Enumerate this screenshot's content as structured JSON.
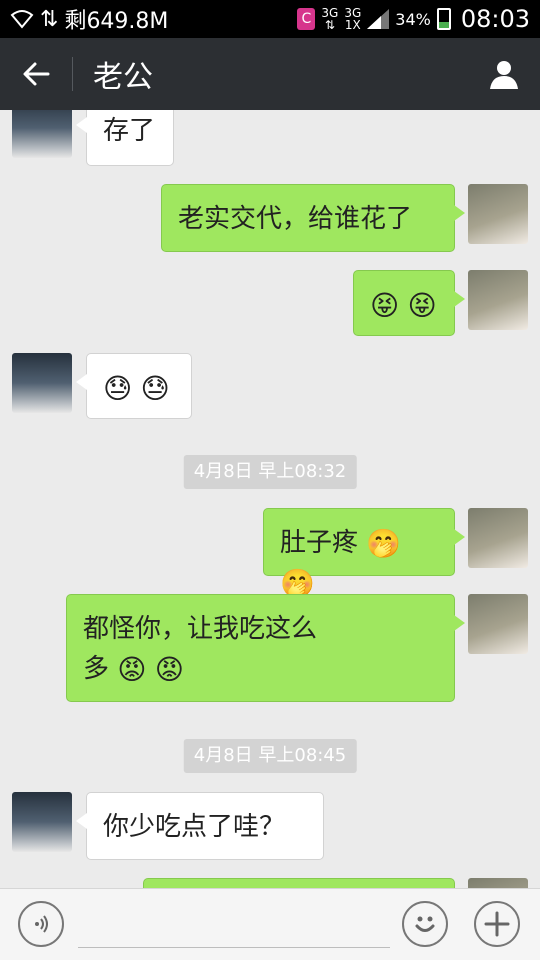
{
  "status_bar": {
    "left_text": "剩649.8M",
    "app_badge": "C",
    "network_top": "3G",
    "network_sim": "3G",
    "network_sim_sub": "1X",
    "battery_percent": "34%",
    "battery_level": 0.34,
    "time": "08:03"
  },
  "header": {
    "title": "老公",
    "back_icon": "arrow-left-icon",
    "profile_icon": "person-icon"
  },
  "messages": [
    {
      "side": "in",
      "text": "存了"
    },
    {
      "side": "out",
      "text": "老实交代，给谁花了"
    },
    {
      "side": "out",
      "emoji": [
        "😝",
        "😝"
      ]
    },
    {
      "side": "in",
      "emoji": [
        "😓",
        "😓"
      ]
    },
    {
      "type": "timestamp",
      "text": "4月8日 早上08:32"
    },
    {
      "side": "out",
      "text": "肚子疼",
      "emoji": [
        "🤭",
        "🤭"
      ]
    },
    {
      "side": "out",
      "line1": "都怪你，让我吃这么",
      "line2": "多",
      "emoji": [
        "😡",
        "😡"
      ]
    },
    {
      "type": "timestamp",
      "text": "4月8日 早上08:45"
    },
    {
      "side": "in",
      "text": "你少吃点了哇？"
    }
  ],
  "input_bar": {
    "voice_icon": "voice-icon",
    "emoji_icon": "smiley-icon",
    "plus_icon": "plus-icon",
    "input_value": ""
  },
  "colors": {
    "outgoing_bubble": "#9fe75f",
    "incoming_bubble": "#ffffff",
    "title_bar": "#2c2f33",
    "chat_background": "#ebebeb"
  }
}
